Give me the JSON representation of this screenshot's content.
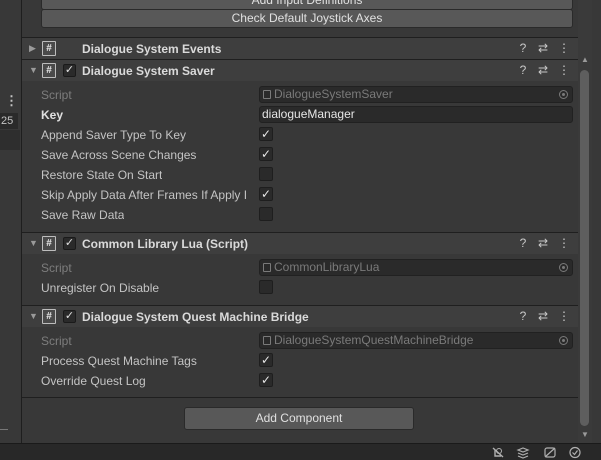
{
  "left_strip": {
    "kebab": "⋮",
    "number": "25"
  },
  "top": {
    "partial_button": "Add Input Definitions",
    "joystick_button": "Check Default Joystick Axes"
  },
  "components": [
    {
      "title": "Dialogue System Events",
      "icons": [
        "help-icon",
        "preset-icon",
        "menu-icon"
      ]
    },
    {
      "title": "Dialogue System Saver",
      "script_label": "Script",
      "script_value": "DialogueSystemSaver",
      "key_label": "Key",
      "key_value": "dialogueManager",
      "fields": [
        {
          "label": "Append Saver Type To Key",
          "checked": true
        },
        {
          "label": "Save Across Scene Changes",
          "checked": true
        },
        {
          "label": "Restore State On Start",
          "checked": false
        },
        {
          "label": "Skip Apply Data After Frames If Apply I",
          "checked": true
        },
        {
          "label": "Save Raw Data",
          "checked": false
        }
      ]
    },
    {
      "title": "Common Library Lua (Script)",
      "script_label": "Script",
      "script_value": "CommonLibraryLua",
      "fields": [
        {
          "label": "Unregister On Disable",
          "checked": false
        }
      ]
    },
    {
      "title": "Dialogue System Quest Machine Bridge",
      "script_label": "Script",
      "script_value": "DialogueSystemQuestMachineBridge",
      "fields": [
        {
          "label": "Process Quest Machine Tags",
          "checked": true
        },
        {
          "label": "Override Quest Log",
          "checked": true
        }
      ]
    }
  ],
  "glyphs": {
    "check": "✓",
    "help": "?",
    "preset": "⇄",
    "menu": "⋮",
    "fold_closed": "▶",
    "fold_open": "▼",
    "hash": "#"
  },
  "add_component": "Add Component",
  "status_icons": [
    "debug-off-icon",
    "layers-icon",
    "visibility-icon",
    "progress-icon"
  ]
}
